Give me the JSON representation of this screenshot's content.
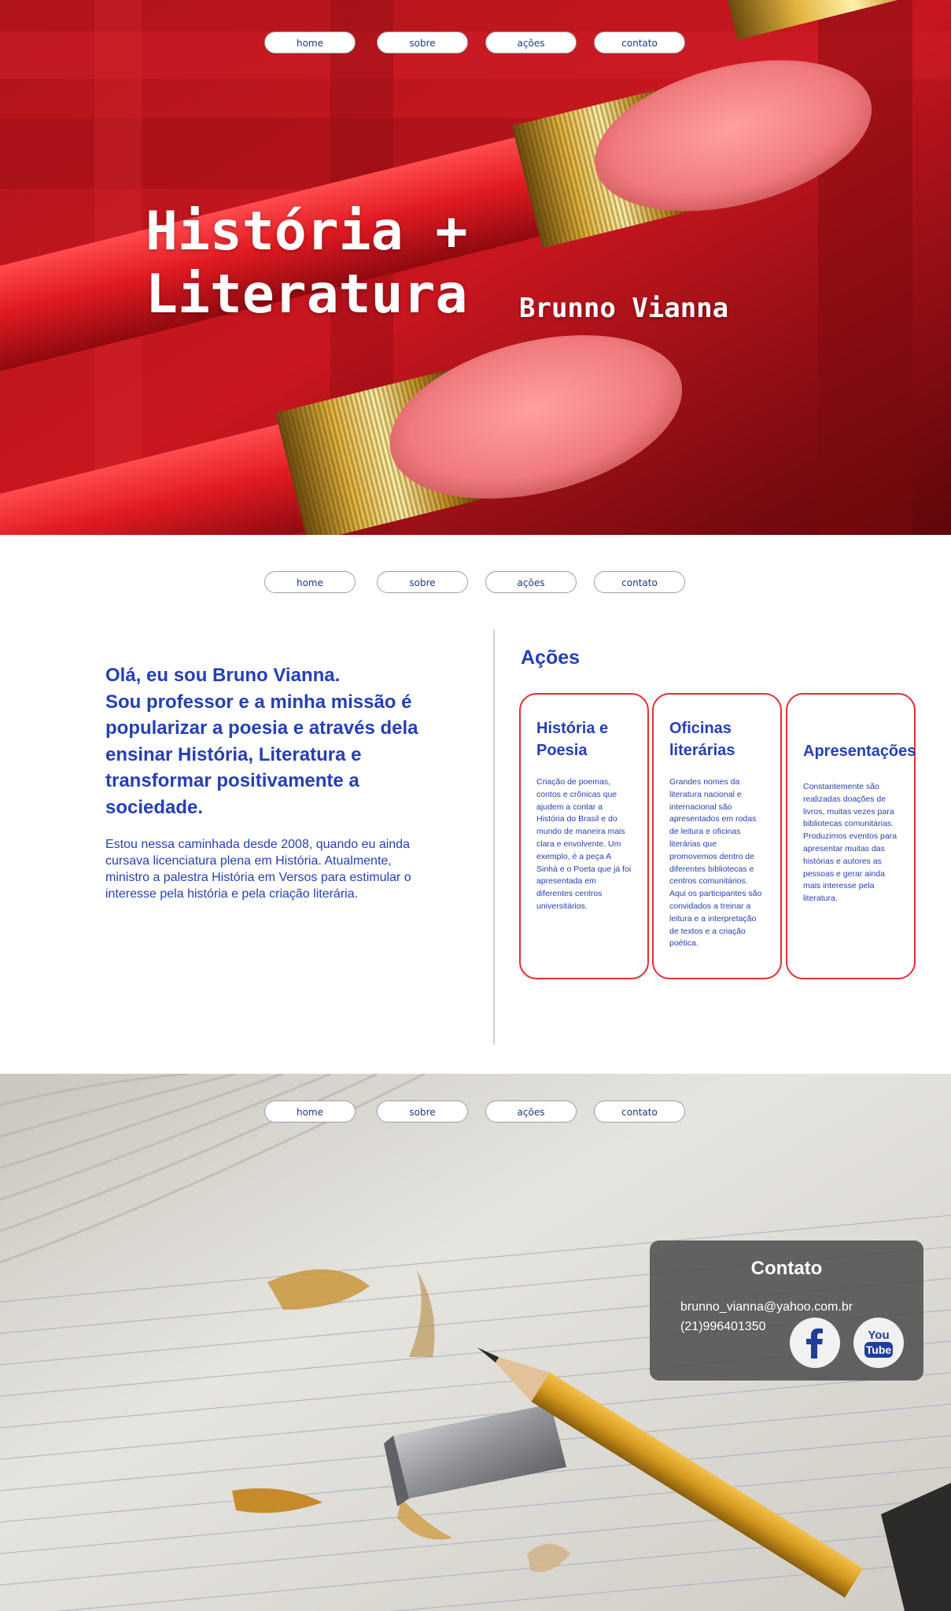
{
  "nav": {
    "home": "home",
    "sobre": "sobre",
    "acoes": "ações",
    "contato": "contato"
  },
  "hero": {
    "title_line1": "História +",
    "title_line2": "Literatura",
    "author": "Brunno Vianna"
  },
  "about": {
    "lead_line1": "Olá, eu sou Bruno Vianna.",
    "lead_line2": "Sou professor e a minha missão é popularizar a poesia e através dela ensinar História, Literatura e transformar positivamente a sociedade.",
    "text": "Estou nessa caminhada desde 2008, quando eu ainda cursava licenciatura plena em História. Atualmente, ministro a palestra História em Versos para estimular o interesse pela história e pela criação literária."
  },
  "acoes": {
    "title": "Ações",
    "cards": [
      {
        "title": "História e Poesia",
        "text": "Criação de poemas, contos e crônicas que ajudem a contar a História do Brasil e do mundo de maneira mais clara e envolvente. Um exemplo, é a peça A Sinhá e o Poeta que já foi apresentada em diferentes centros universitários."
      },
      {
        "title": "Oficinas literárias",
        "text": "Grandes nomes da literatura nacional e internacional são apresentados em rodas de leitura e oficinas literárias que promovemos dentro de diferentes bibliotecas e centros comunitários. Aqui os participantes são convidados a treinar a leitura e a interpretação de textos e a criação poética."
      },
      {
        "title": "Apresentações",
        "text": "Constantemente são realizadas doações de livros, muitas vezes para bibliotecas comunitárias. Produzimos eventos para apresentar muitas das histórias e autores as pessoas e gerar ainda mais interesse pela literatura."
      }
    ]
  },
  "contact": {
    "title": "Contato",
    "email": "brunno_vianna@yahoo.com.br",
    "phone": "(21)996401350",
    "facebook_icon": "facebook-icon",
    "youtube_icon": "youtube-icon",
    "youtube_icon_text_1": "You",
    "youtube_icon_text_2": "Tube"
  },
  "colors": {
    "accent": "#2540b4",
    "card_border": "#e03036",
    "hero_red": "#c8141c"
  }
}
